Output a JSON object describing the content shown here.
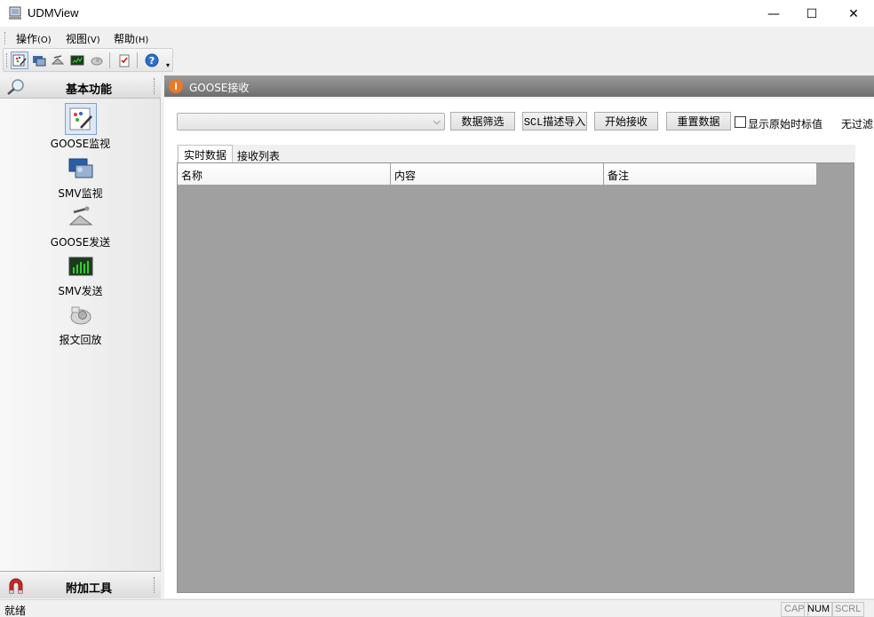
{
  "window": {
    "title": "UDMView",
    "minimize_glyph": "—",
    "maximize_glyph": "☐",
    "close_glyph": "✕"
  },
  "menu": [
    {
      "label": "操作",
      "accel": "(O)"
    },
    {
      "label": "视图",
      "accel": "(V)"
    },
    {
      "label": "帮助",
      "accel": "(H)"
    }
  ],
  "toolbar": {
    "buttons": [
      "goose-monitor-icon",
      "smv-monitor-icon",
      "goose-send-icon",
      "smv-send-icon",
      "replay-icon",
      "checklist-icon",
      "help-icon"
    ],
    "more_glyph": "▾"
  },
  "left_panel": {
    "title": "基本功能",
    "items": [
      {
        "label": "GOOSE监视",
        "icon": "goose-monitor-icon"
      },
      {
        "label": "SMV监视",
        "icon": "smv-monitor-icon"
      },
      {
        "label": "GOOSE发送",
        "icon": "goose-send-icon"
      },
      {
        "label": "SMV发送",
        "icon": "smv-send-icon"
      },
      {
        "label": "报文回放",
        "icon": "replay-icon"
      }
    ],
    "footer_title": "附加工具"
  },
  "content": {
    "panel_title": "GOOSE接收",
    "panel_icon_glyph": "i",
    "combo_value": "",
    "combo_arrow": "⌵",
    "buttons": {
      "filter": "数据筛选",
      "scl_import": "SCL描述导入",
      "start": "开始接收",
      "reset": "重置数据"
    },
    "show_raw_label": "显示原始时标值",
    "show_raw_checked": false,
    "filter_status": "无过滤",
    "tabs": [
      "实时数据",
      "接收列表"
    ],
    "active_tab": 0,
    "columns": [
      "名称",
      "内容",
      "备注"
    ]
  },
  "status": {
    "text": "就绪",
    "cap": "CAP",
    "num": "NUM",
    "scrl": "SCRL"
  },
  "colors": {
    "panel_title_bg": "#7f7f7f",
    "grid_bg": "#a0a0a0",
    "accent": "#e87a2a"
  }
}
